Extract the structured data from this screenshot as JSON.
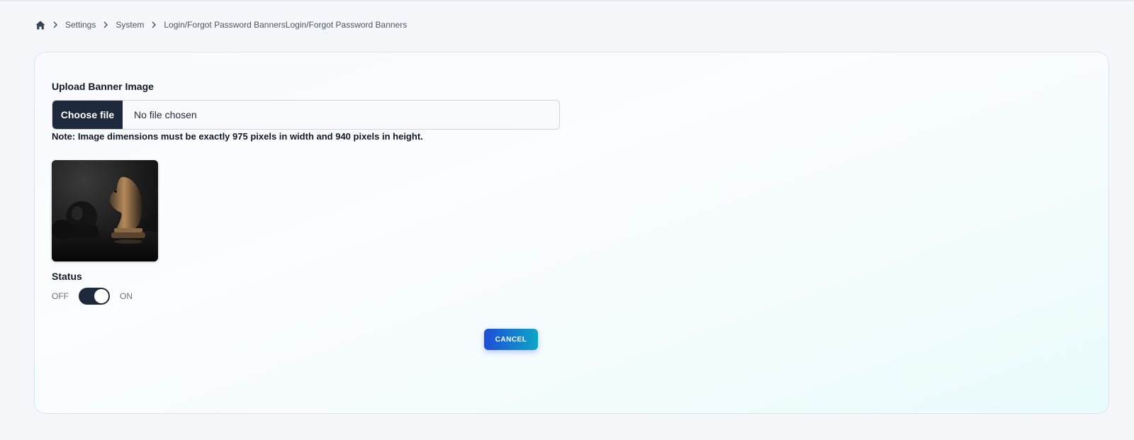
{
  "breadcrumb": {
    "home_icon": "home-icon",
    "separator_icon": "chevron-right-icon",
    "items": [
      {
        "label": "Settings"
      },
      {
        "label": "System"
      },
      {
        "label": "Login/Forgot Password BannersLogin/Forgot Password Banners"
      }
    ]
  },
  "form": {
    "upload_label": "Upload Banner Image",
    "file_button_label": "Choose file",
    "file_status": "No file chosen",
    "note": "Note: Image dimensions must be exactly 975 pixels in width and 940 pixels in height.",
    "preview_icon": "chess-knight-image",
    "status_label": "Status",
    "toggle_off_label": "OFF",
    "toggle_on_label": "ON",
    "toggle_state": "on",
    "cancel_label": "CANCEL"
  },
  "colors": {
    "toggle": "#1e293b",
    "file_button": "#1e293b",
    "cancel_gradient_start": "#1d4ed8",
    "cancel_gradient_end": "#0ea5c6"
  }
}
